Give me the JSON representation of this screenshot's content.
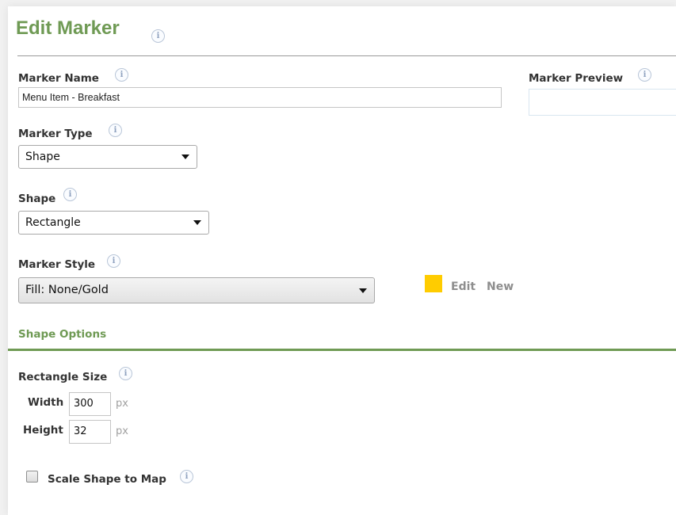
{
  "header": {
    "title": "Edit Marker"
  },
  "info_glyph": "i",
  "marker_name": {
    "label": "Marker Name",
    "value": "Menu Item - Breakfast"
  },
  "marker_preview": {
    "label": "Marker Preview"
  },
  "marker_type": {
    "label": "Marker Type",
    "selected": "Shape"
  },
  "shape": {
    "label": "Shape",
    "selected": "Rectangle"
  },
  "marker_style": {
    "label": "Marker Style",
    "selected": "Fill: None/Gold",
    "swatch_color": "#ffcc00",
    "edit_label": "Edit",
    "new_label": "New"
  },
  "shape_options": {
    "title": "Shape Options",
    "rectangle_size": {
      "label": "Rectangle Size",
      "width_label": "Width",
      "width_value": "300",
      "height_label": "Height",
      "height_value": "32",
      "unit": "px"
    },
    "scale_shape": {
      "label": "Scale Shape to Map",
      "checked": false
    }
  },
  "colors": {
    "accent": "#6f9a54",
    "info_icon": "#8fa2bf"
  }
}
